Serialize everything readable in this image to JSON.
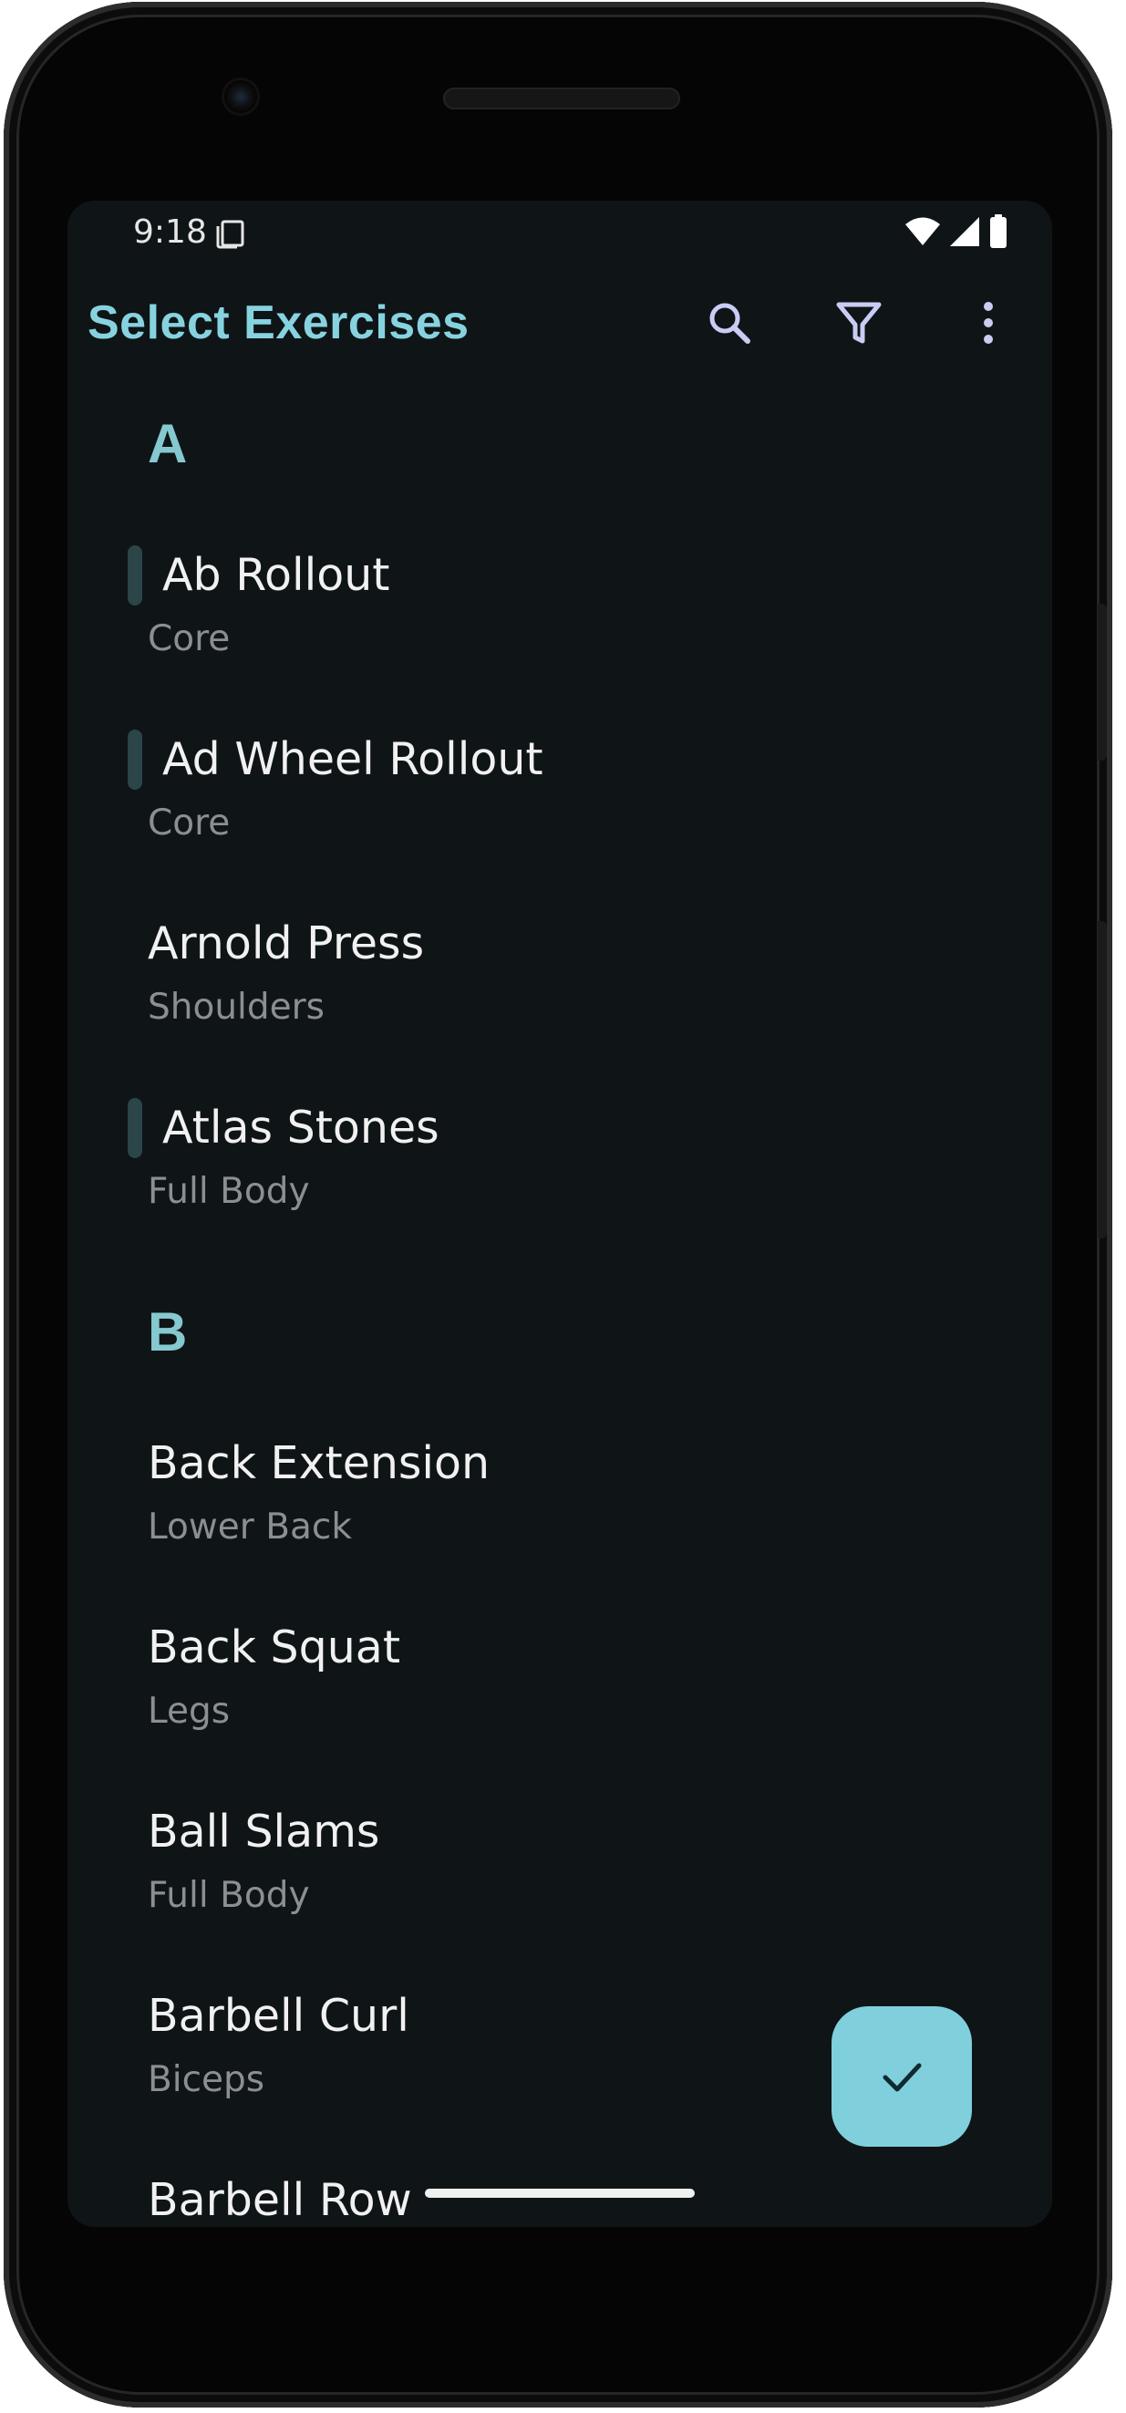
{
  "status_bar": {
    "time": "9:18"
  },
  "app_bar": {
    "title": "Select Exercises",
    "actions": [
      "search-icon",
      "filter-icon",
      "more-vert-icon"
    ]
  },
  "sections": [
    {
      "letter": "A",
      "items": [
        {
          "name": "Ab Rollout",
          "category": "Core",
          "selected": true
        },
        {
          "name": "Ad Wheel Rollout",
          "category": "Core",
          "selected": true
        },
        {
          "name": "Arnold Press",
          "category": "Shoulders",
          "selected": false
        },
        {
          "name": "Atlas Stones",
          "category": "Full Body",
          "selected": true
        }
      ]
    },
    {
      "letter": "B",
      "items": [
        {
          "name": "Back Extension",
          "category": "Lower Back",
          "selected": false
        },
        {
          "name": "Back Squat",
          "category": "Legs",
          "selected": false
        },
        {
          "name": "Ball Slams",
          "category": "Full Body",
          "selected": false
        },
        {
          "name": "Barbell Curl",
          "category": "Biceps",
          "selected": false
        },
        {
          "name": "Barbell Row",
          "category": "",
          "selected": false
        }
      ]
    }
  ],
  "fab": {
    "icon": "check-icon"
  },
  "colors": {
    "screen_background": "#0f1417",
    "accent": "#86d3df",
    "section_header": "#86c8cf",
    "fab": "#7fd0dc",
    "selection_indicator": "#2b4548",
    "item_name": "#f1f1f1",
    "item_category": "#8b8f91"
  }
}
